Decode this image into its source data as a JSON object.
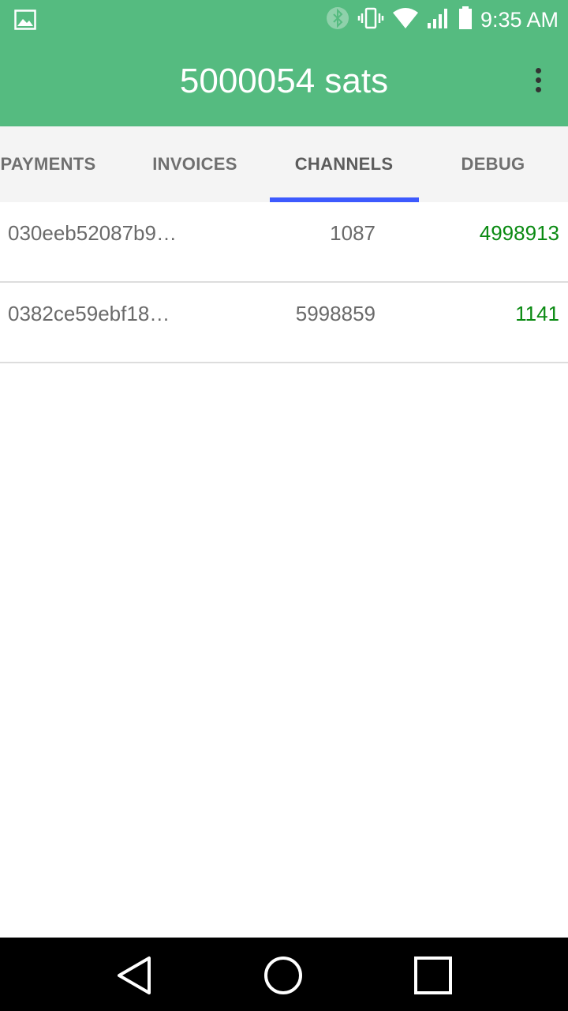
{
  "status_bar": {
    "time": "9:35 AM",
    "icons": [
      "image-icon",
      "bluetooth-icon",
      "vibrate-icon",
      "wifi-icon",
      "signal-icon",
      "battery-icon"
    ]
  },
  "app_bar": {
    "title": "5000054 sats",
    "overflow_icon": "more-vert-icon"
  },
  "tabs": [
    {
      "label": "PAYMENTS",
      "active": false
    },
    {
      "label": "INVOICES",
      "active": false
    },
    {
      "label": "CHANNELS",
      "active": true
    },
    {
      "label": "DEBUG",
      "active": false
    }
  ],
  "channels": [
    {
      "node_id": "030eeb52087b9…",
      "local": "1087",
      "remote": "4998913"
    },
    {
      "node_id": "0382ce59ebf18…",
      "local": "5998859",
      "remote": "1141"
    }
  ],
  "nav_bar": {
    "back_icon": "back-triangle-icon",
    "home_icon": "home-circle-icon",
    "recents_icon": "recents-square-icon"
  },
  "colors": {
    "primary": "#55bb80",
    "tab_indicator": "#3d5afe",
    "positive_amount": "#0a8a12"
  }
}
